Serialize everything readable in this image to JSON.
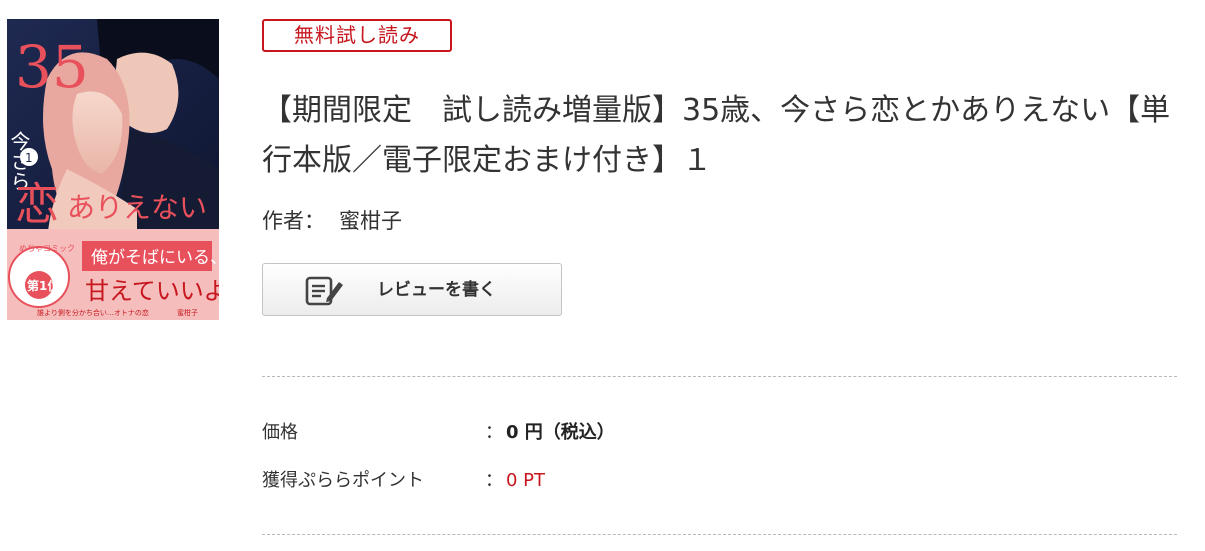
{
  "badge": {
    "label": "無料試し読み",
    "color": "#c7161d"
  },
  "book": {
    "title": "【期間限定　試し読み増量版】35歳、今さら恋とかありえない【単行本版／電子限定おまけ付き】１",
    "author_label": "作者：",
    "author_name": "蜜柑子",
    "cover": {
      "title_number": "35",
      "title_line1": "今さら",
      "title_line2": "恋とかありえない",
      "volume": "1",
      "tagline1": "俺がそばにいる、",
      "tagline2": "甘えていいよ。",
      "badge_top": "めちゃコミック",
      "badge_rank": "第1位",
      "footer": "誰より側を分かち合い…オトナの恋",
      "author": "蜜柑子"
    }
  },
  "review_button": {
    "label": "レビューを書く",
    "icon": "edit-icon"
  },
  "details": {
    "price": {
      "label": "価格",
      "separator": "：",
      "value": "0 円（税込）"
    },
    "points": {
      "label": "獲得ぷららポイント",
      "separator": "：",
      "value": "0 PT",
      "color": "#c7161d"
    }
  }
}
